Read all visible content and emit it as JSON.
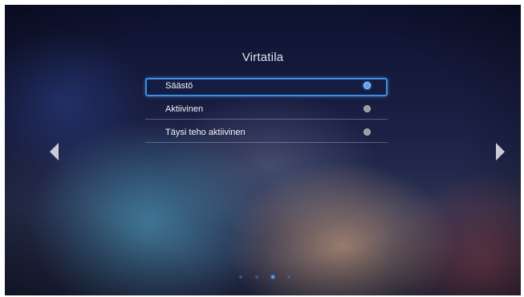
{
  "screen": {
    "title": "Virtatila"
  },
  "menu": {
    "items": [
      {
        "label": "Säästö",
        "selected": true
      },
      {
        "label": "Aktiivinen",
        "selected": false
      },
      {
        "label": "Täysi teho aktiivinen",
        "selected": false
      }
    ]
  },
  "navigation": {
    "left_arrow_icon": "triangle-left-icon",
    "right_arrow_icon": "triangle-right-icon"
  },
  "pager": {
    "total_pages": 4,
    "current_page": 3
  },
  "colors": {
    "accent": "#4fa3ff",
    "selection_border": "#3f8fe0",
    "radio_inactive": "#9a9ca4"
  }
}
